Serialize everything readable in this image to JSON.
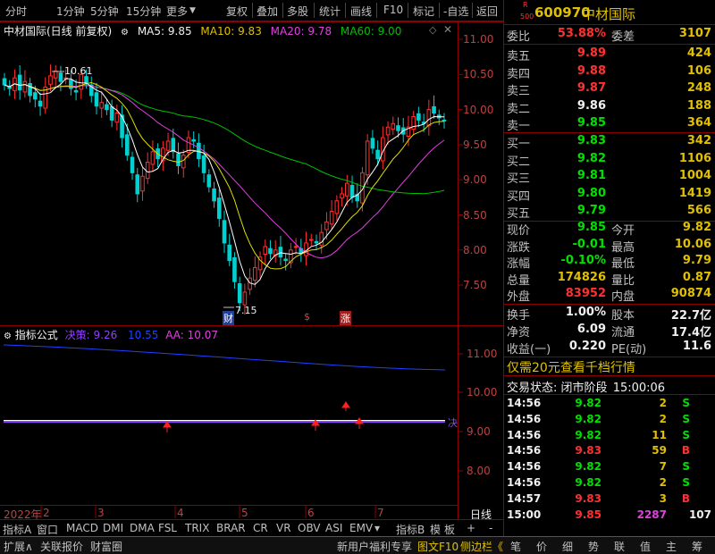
{
  "toolbar": {
    "left": [
      "分时",
      "1分钟",
      "5分钟",
      "15分钟",
      "更多"
    ],
    "right": [
      "复权",
      "叠加",
      "多股",
      "统计",
      "画线",
      "F10",
      "标记",
      "-自选",
      "返回"
    ]
  },
  "main_chart": {
    "title": "中材国际(日线 前复权)",
    "ma5_label": "MA5: 9.85",
    "ma10_label": "MA10: 9.83",
    "ma20_label": "MA20: 9.78",
    "ma60_label": "MA60: 9.00",
    "y_ticks": [
      "11.00",
      "10.50",
      "10.00",
      "9.50",
      "9.00",
      "8.50",
      "8.00",
      "7.50"
    ],
    "high_annotation": "10.61",
    "low_annotation": "7.15",
    "markers": [
      "财",
      "$",
      "涨"
    ]
  },
  "indicator": {
    "title": "指标公式",
    "juece_label": "决策: 9.26",
    "blue_value": "10.55",
    "aa_label": "AA: 10.07",
    "y_ticks": [
      "11.00",
      "10.00",
      "9.00",
      "8.00"
    ],
    "line_end_label": "决"
  },
  "x_axis": {
    "year": "2022年",
    "months": [
      "2",
      "3",
      "4",
      "5",
      "6",
      "7"
    ],
    "period": "日线"
  },
  "indicator_tabs": [
    "指标A",
    "窗口",
    "MACD",
    "DMI",
    "DMA",
    "FSL",
    "TRIX",
    "BRAR",
    "CR",
    "VR",
    "OBV",
    "ASI",
    "EMV",
    "指标B",
    "模",
    "板",
    "+",
    "-"
  ],
  "status_bar": {
    "left": [
      "扩展∧",
      "关联报价",
      "财富圈"
    ],
    "right": [
      "新用户福利专享",
      "图文F10",
      "侧边栏《"
    ],
    "nav": [
      "笔",
      "价",
      "细",
      "势",
      "联",
      "值",
      "主",
      "筹"
    ]
  },
  "stock": {
    "code": "600970",
    "name": "中材国际",
    "badge_top": "R",
    "badge_bottom": "500"
  },
  "order_book": {
    "weibi_label": "委比",
    "weibi": "53.88%",
    "weicha_label": "委差",
    "weicha": "3107",
    "asks": [
      {
        "label": "卖五",
        "price": "9.89",
        "vol": "424"
      },
      {
        "label": "卖四",
        "price": "9.88",
        "vol": "106"
      },
      {
        "label": "卖三",
        "price": "9.87",
        "vol": "248"
      },
      {
        "label": "卖二",
        "price": "9.86",
        "vol": "188"
      },
      {
        "label": "卖一",
        "price": "9.85",
        "vol": "364"
      }
    ],
    "bids": [
      {
        "label": "买一",
        "price": "9.83",
        "vol": "342"
      },
      {
        "label": "买二",
        "price": "9.82",
        "vol": "1106"
      },
      {
        "label": "买三",
        "price": "9.81",
        "vol": "1004"
      },
      {
        "label": "买四",
        "price": "9.80",
        "vol": "1419"
      },
      {
        "label": "买五",
        "price": "9.79",
        "vol": "566"
      }
    ]
  },
  "quote": [
    {
      "l1": "现价",
      "v1": "9.85",
      "l2": "今开",
      "v2": "9.82"
    },
    {
      "l1": "涨跌",
      "v1": "-0.01",
      "l2": "最高",
      "v2": "10.06"
    },
    {
      "l1": "涨幅",
      "v1": "-0.10%",
      "l2": "最低",
      "v2": "9.79"
    },
    {
      "l1": "总量",
      "v1": "174826",
      "l2": "量比",
      "v2": "0.87"
    },
    {
      "l1": "外盘",
      "v1": "83952",
      "l2": "内盘",
      "v2": "90874"
    }
  ],
  "fundamentals": [
    {
      "l1": "换手",
      "v1": "1.00%",
      "l2": "股本",
      "v2": "22.7亿"
    },
    {
      "l1": "净资",
      "v1": "6.09",
      "l2": "流通",
      "v2": "17.4亿"
    },
    {
      "l1": "收益(一)",
      "v1": "0.220",
      "l2": "PE(动)",
      "v2": "11.6"
    }
  ],
  "promo": "仅需20元查看千档行情",
  "trade_status": {
    "label": "交易状态:",
    "value": "闭市阶段",
    "time": "15:00:06"
  },
  "ticks": [
    {
      "time": "14:56",
      "price": "9.82",
      "vol": "2",
      "side": "S"
    },
    {
      "time": "14:56",
      "price": "9.82",
      "vol": "2",
      "side": "S"
    },
    {
      "time": "14:56",
      "price": "9.82",
      "vol": "11",
      "side": "S"
    },
    {
      "time": "14:56",
      "price": "9.83",
      "vol": "59",
      "side": "B"
    },
    {
      "time": "14:56",
      "price": "9.82",
      "vol": "7",
      "side": "S"
    },
    {
      "time": "14:56",
      "price": "9.82",
      "vol": "2",
      "side": "S"
    },
    {
      "time": "14:57",
      "price": "9.83",
      "vol": "3",
      "side": "B"
    },
    {
      "time": "15:00",
      "price": "9.85",
      "vol": "2287",
      "side": "107"
    }
  ],
  "colors": {
    "up": "#ff3030",
    "down": "#00d0d0",
    "ma5": "#ffffff",
    "ma10": "#e0e000",
    "ma20": "#e040e0",
    "ma60": "#00c000",
    "grid": "#8b0000"
  }
}
